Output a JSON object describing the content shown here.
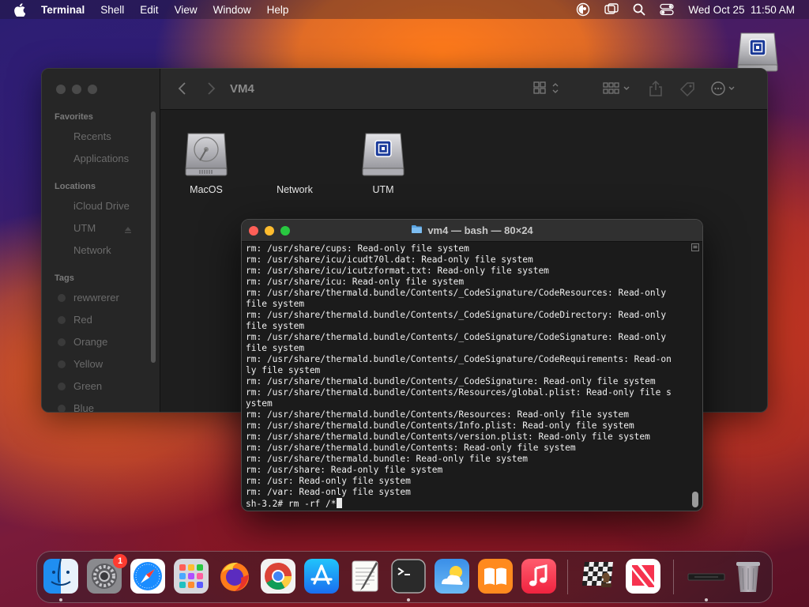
{
  "menubar": {
    "app_name": "Terminal",
    "menus": [
      "Shell",
      "Edit",
      "View",
      "Window",
      "Help"
    ],
    "datetime": "Wed Oct 25  11:50 AM"
  },
  "finder": {
    "title": "VM4",
    "sidebar": {
      "favorites_heading": "Favorites",
      "favorites": [
        "Recents",
        "Applications"
      ],
      "locations_heading": "Locations",
      "locations": [
        "iCloud Drive",
        "UTM",
        "Network"
      ],
      "tags_heading": "Tags",
      "tags": [
        {
          "label": "rewwrerer",
          "color": "#3a3a3a"
        },
        {
          "label": "Red",
          "color": "#3a3a3a"
        },
        {
          "label": "Orange",
          "color": "#3a3a3a"
        },
        {
          "label": "Yellow",
          "color": "#3a3a3a"
        },
        {
          "label": "Green",
          "color": "#3a3a3a"
        },
        {
          "label": "Blue",
          "color": "#3a3a3a"
        }
      ]
    },
    "items": [
      {
        "label": "MacOS",
        "icon": "hard-drive-icon"
      },
      {
        "label": "Network",
        "icon": "network-icon"
      },
      {
        "label": "UTM",
        "icon": "utm-drive-icon"
      }
    ]
  },
  "terminal": {
    "title": "vm4 — bash — 80×24",
    "lines": [
      "rm: /usr/share/cups: Read-only file system",
      "rm: /usr/share/icu/icudt70l.dat: Read-only file system",
      "rm: /usr/share/icu/icutzformat.txt: Read-only file system",
      "rm: /usr/share/icu: Read-only file system",
      "rm: /usr/share/thermald.bundle/Contents/_CodeSignature/CodeResources: Read-only",
      "file system",
      "rm: /usr/share/thermald.bundle/Contents/_CodeSignature/CodeDirectory: Read-only",
      "file system",
      "rm: /usr/share/thermald.bundle/Contents/_CodeSignature/CodeSignature: Read-only",
      "file system",
      "rm: /usr/share/thermald.bundle/Contents/_CodeSignature/CodeRequirements: Read-on",
      "ly file system",
      "rm: /usr/share/thermald.bundle/Contents/_CodeSignature: Read-only file system",
      "rm: /usr/share/thermald.bundle/Contents/Resources/global.plist: Read-only file s",
      "ystem",
      "rm: /usr/share/thermald.bundle/Contents/Resources: Read-only file system",
      "rm: /usr/share/thermald.bundle/Contents/Info.plist: Read-only file system",
      "rm: /usr/share/thermald.bundle/Contents/version.plist: Read-only file system",
      "rm: /usr/share/thermald.bundle/Contents: Read-only file system",
      "rm: /usr/share/thermald.bundle: Read-only file system",
      "rm: /usr/share: Read-only file system",
      "rm: /usr: Read-only file system",
      "rm: /var: Read-only file system"
    ],
    "prompt": "sh-3.2# rm -rf /*"
  },
  "dock": {
    "apps": [
      {
        "name": "finder",
        "running": true
      },
      {
        "name": "system-settings",
        "running": false,
        "badge": "1"
      },
      {
        "name": "safari",
        "running": false
      },
      {
        "name": "launchpad",
        "running": false
      },
      {
        "name": "firefox",
        "running": false
      },
      {
        "name": "chrome",
        "running": false
      },
      {
        "name": "app-store",
        "running": false
      },
      {
        "name": "textedit",
        "running": false
      },
      {
        "name": "terminal",
        "running": true
      },
      {
        "name": "weather",
        "running": false
      },
      {
        "name": "books",
        "running": false
      },
      {
        "name": "music",
        "running": false
      },
      {
        "name": "chess",
        "running": false
      },
      {
        "name": "news",
        "running": false
      },
      {
        "name": "utm-window",
        "running": true
      },
      {
        "name": "trash",
        "running": false
      }
    ],
    "settings_badge": "1"
  }
}
